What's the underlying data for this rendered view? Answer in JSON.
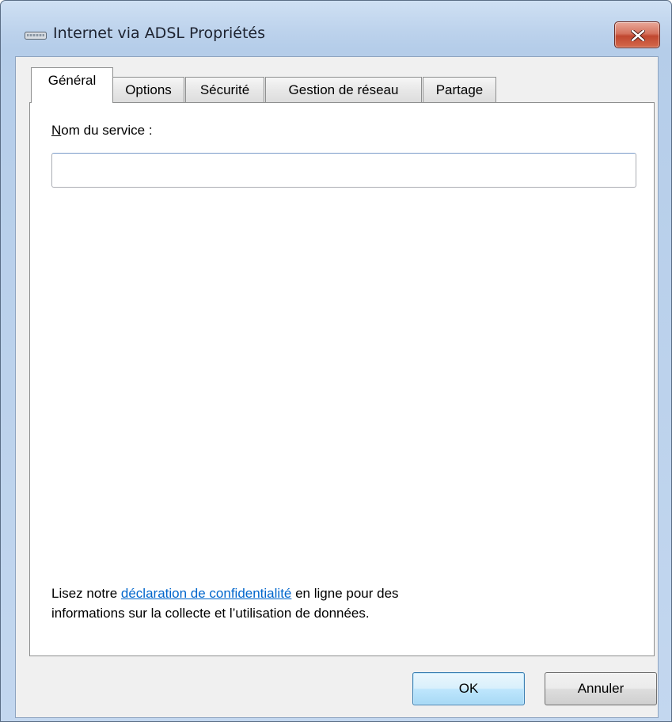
{
  "window": {
    "title": "Internet via ADSL Propriétés",
    "icon": "network-connection-icon"
  },
  "tabs": [
    {
      "label": "Général",
      "active": true
    },
    {
      "label": "Options",
      "active": false
    },
    {
      "label": "Sécurité",
      "active": false
    },
    {
      "label": "Gestion de réseau",
      "active": false
    },
    {
      "label": "Partage",
      "active": false
    }
  ],
  "general": {
    "service_name_label_accesskey": "N",
    "service_name_label_rest": "om du service :",
    "service_name_value": "",
    "privacy_prefix": "Lisez notre ",
    "privacy_link": "déclaration de confidentialité",
    "privacy_suffix_line1": " en ligne pour des",
    "privacy_line2": "informations sur la collecte et l’utilisation de données."
  },
  "buttons": {
    "ok": "OK",
    "cancel": "Annuler"
  },
  "colors": {
    "link": "#0066cc",
    "close_button": "#c0472f",
    "default_button_border": "#3c7fb1"
  }
}
